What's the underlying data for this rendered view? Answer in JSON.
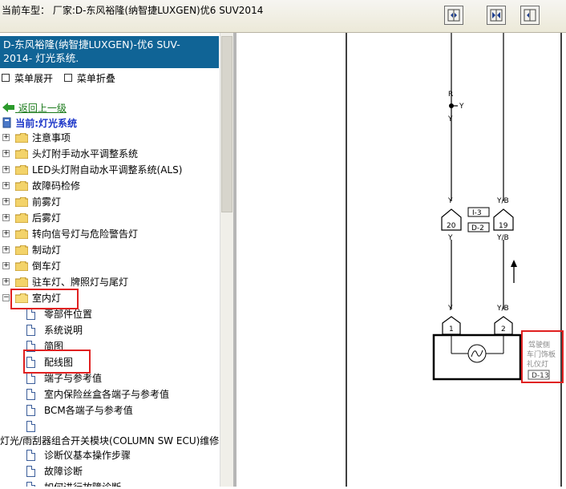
{
  "topbar": {
    "vehicle_label": "当前车型：  厂家:D-东风裕隆(纳智捷LUXGEN)优6 SUV2014",
    "buttons": [
      "dock-left-icon",
      "split-view-icon",
      "dock-right-icon"
    ]
  },
  "sidebar": {
    "header_line1": "D-东风裕隆(纳智捷LUXGEN)-优6 SUV-",
    "header_line2": "2014- 灯光系统.",
    "expand_label": "菜单展开",
    "collapse_label": "菜单折叠",
    "back_label": "返回上一级",
    "current_label": "当前:灯光系统",
    "folders": [
      "注意事项",
      "头灯附手动水平调整系统",
      "LED头灯附自动水平调整系统(ALS)",
      "故障码检修",
      "前雾灯",
      "后雾灯",
      "转向信号灯与危险警告灯",
      "制动灯",
      "倒车灯",
      "驻车灯、牌照灯与尾灯",
      "室内灯"
    ],
    "docs": [
      "零部件位置",
      "系统说明",
      "简图",
      "配线图",
      "端子与参考值",
      "室内保险丝盒各端子与参考值",
      "BCM各端子与参考值",
      ""
    ],
    "section2": "灯光/雨刮器组合开关模块(COLUMN SW ECU)维修",
    "docs2": [
      "诊断仪基本操作步骤",
      "故障诊断",
      "如何进行故障诊断"
    ]
  },
  "diagram": {
    "wire_labels": {
      "r": "R",
      "y_top": "Y",
      "y_branch": "Y",
      "y1": "Y",
      "yb1": "Y/B",
      "y2": "Y",
      "yb2": "Y/B",
      "y3": "Y",
      "yb3": "Y/B"
    },
    "connector_pins": [
      "20",
      "19"
    ],
    "connector_codes": [
      "I-3",
      "D-2"
    ],
    "lamp_pins": [
      "1",
      "2"
    ],
    "lamp_label_line1": "驾驶侧",
    "lamp_label_line2": "车门饰板",
    "lamp_label_line3": "礼仪灯",
    "lamp_code": "D-13"
  }
}
